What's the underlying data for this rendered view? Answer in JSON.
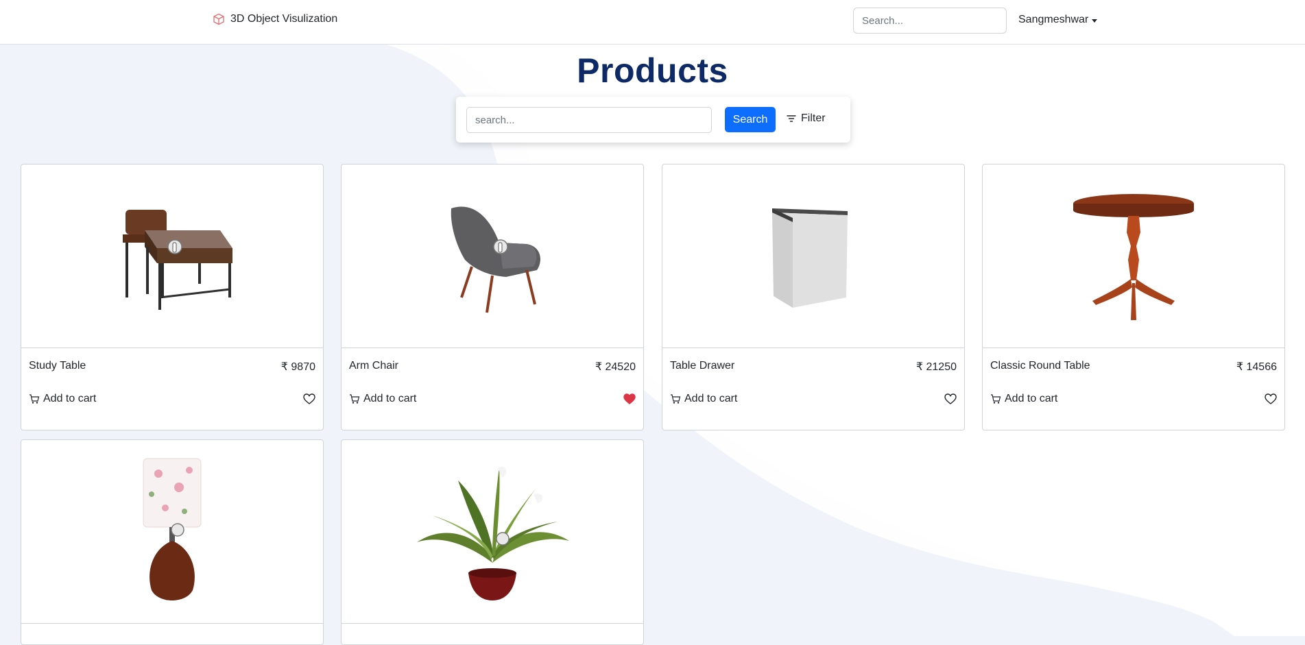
{
  "navbar": {
    "brand": "3D Object Visulization",
    "brand_icon": "cube-icon",
    "search_placeholder": "Search...",
    "user": "Sangmeshwar"
  },
  "header": {
    "title": "Products",
    "search_placeholder": "search...",
    "search_button": "Search",
    "filter_label": "Filter"
  },
  "colors": {
    "primary": "#0d6efd",
    "title": "#0d2a66",
    "liked_heart": "#dc3545",
    "background": "#f0f3fa"
  },
  "products": [
    {
      "name": "Study Table",
      "price": "₹ 9870",
      "cart_label": "Add to cart",
      "liked": false
    },
    {
      "name": "Arm Chair",
      "price": "₹ 24520",
      "cart_label": "Add to cart",
      "liked": true
    },
    {
      "name": "Table Drawer",
      "price": "₹ 21250",
      "cart_label": "Add to cart",
      "liked": false
    },
    {
      "name": "Classic Round Table",
      "price": "₹ 14566",
      "cart_label": "Add to cart",
      "liked": false
    },
    {
      "name": "",
      "price": "",
      "cart_label": "",
      "liked": false
    },
    {
      "name": "",
      "price": "",
      "cart_label": "",
      "liked": false
    }
  ]
}
